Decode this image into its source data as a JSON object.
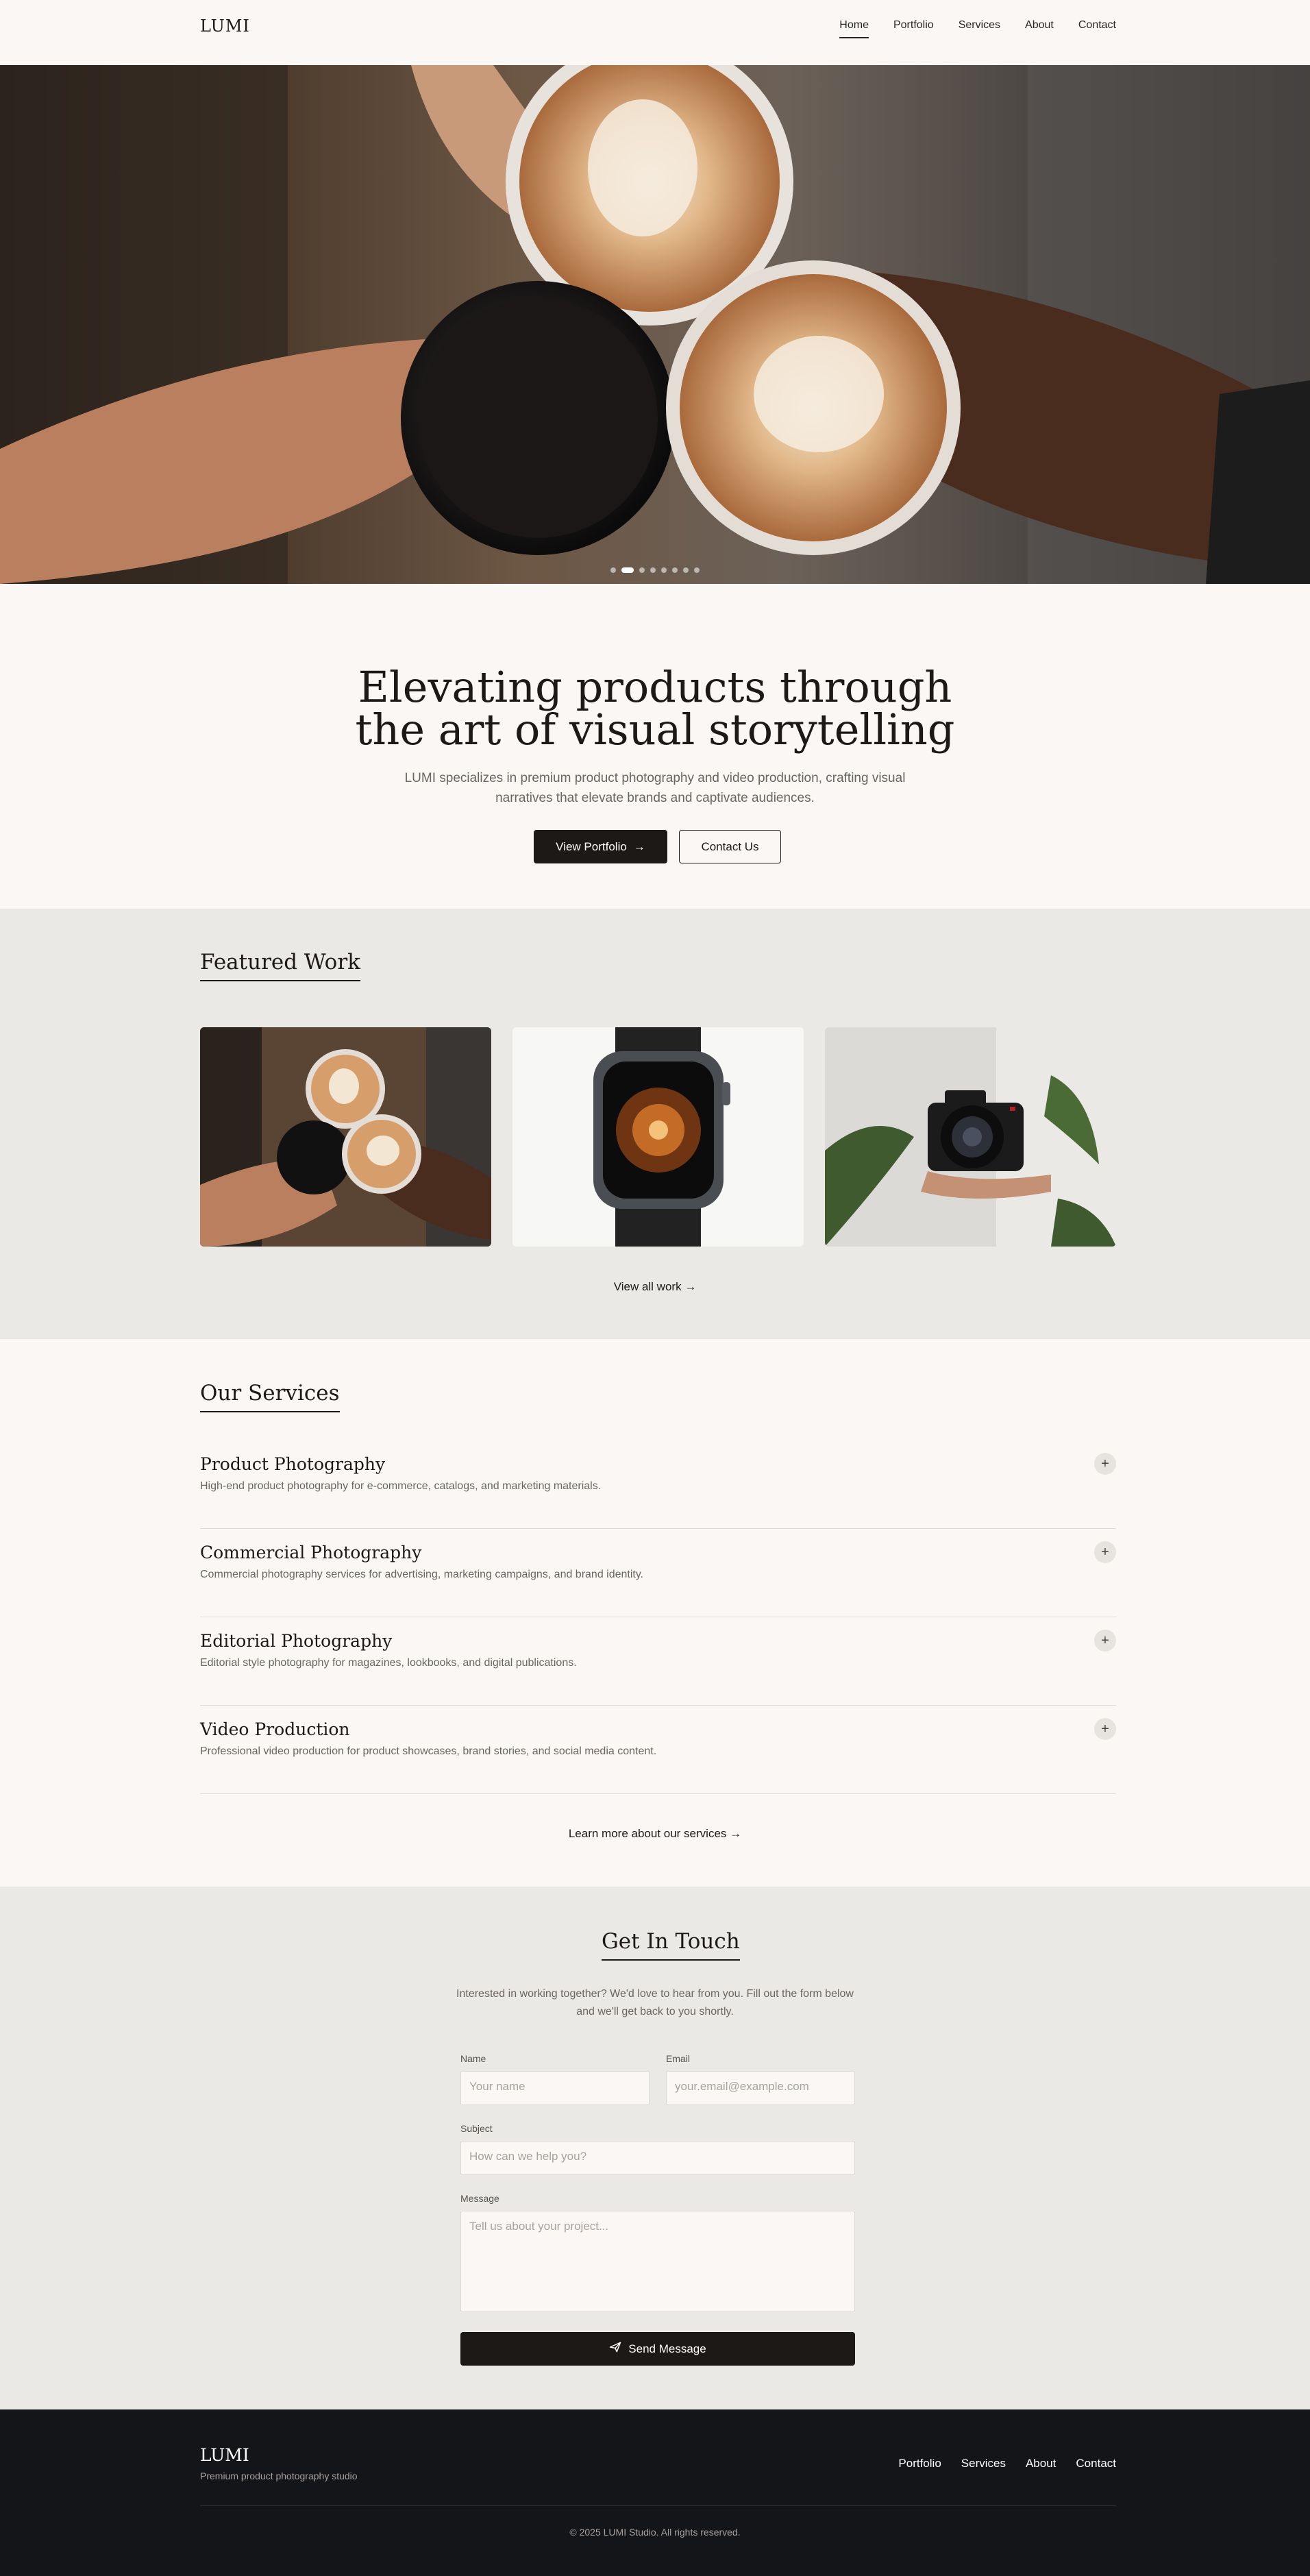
{
  "header": {
    "logo": "LUMI",
    "nav": [
      {
        "label": "Home",
        "active": true
      },
      {
        "label": "Portfolio",
        "active": false
      },
      {
        "label": "Services",
        "active": false
      },
      {
        "label": "About",
        "active": false
      },
      {
        "label": "Contact",
        "active": false
      }
    ]
  },
  "hero": {
    "slide_count": 8,
    "active_slide": 2
  },
  "intro": {
    "title_line1": "Elevating products through",
    "title_line2": "the art of visual storytelling",
    "subtitle": "LUMI specializes in premium product photography and video production, crafting visual narratives that elevate brands and captivate audiences.",
    "primary_button": "View Portfolio",
    "secondary_button": "Contact Us"
  },
  "featured": {
    "title": "Featured Work",
    "view_all": "View all work"
  },
  "services": {
    "title": "Our Services",
    "items": [
      {
        "title": "Product Photography",
        "desc": "High-end product photography for e-commerce, catalogs, and marketing materials."
      },
      {
        "title": "Commercial Photography",
        "desc": "Commercial photography services for advertising, marketing campaigns, and brand identity."
      },
      {
        "title": "Editorial Photography",
        "desc": "Editorial style photography for magazines, lookbooks, and digital publications."
      },
      {
        "title": "Video Production",
        "desc": "Professional video production for product showcases, brand stories, and social media content."
      }
    ],
    "learn_more": "Learn more about our services"
  },
  "contact": {
    "title": "Get In Touch",
    "subtitle": "Interested in working together? We'd love to hear from you. Fill out the form below and we'll get back to you shortly.",
    "name_label": "Name",
    "name_placeholder": "Your name",
    "email_label": "Email",
    "email_placeholder": "your.email@example.com",
    "subject_label": "Subject",
    "subject_placeholder": "How can we help you?",
    "message_label": "Message",
    "message_placeholder": "Tell us about your project...",
    "send_button": "Send Message"
  },
  "footer": {
    "logo": "LUMI",
    "tagline": "Premium product photography studio",
    "nav": [
      "Portfolio",
      "Services",
      "About",
      "Contact"
    ],
    "copyright": "© 2025 LUMI Studio. All rights reserved."
  }
}
